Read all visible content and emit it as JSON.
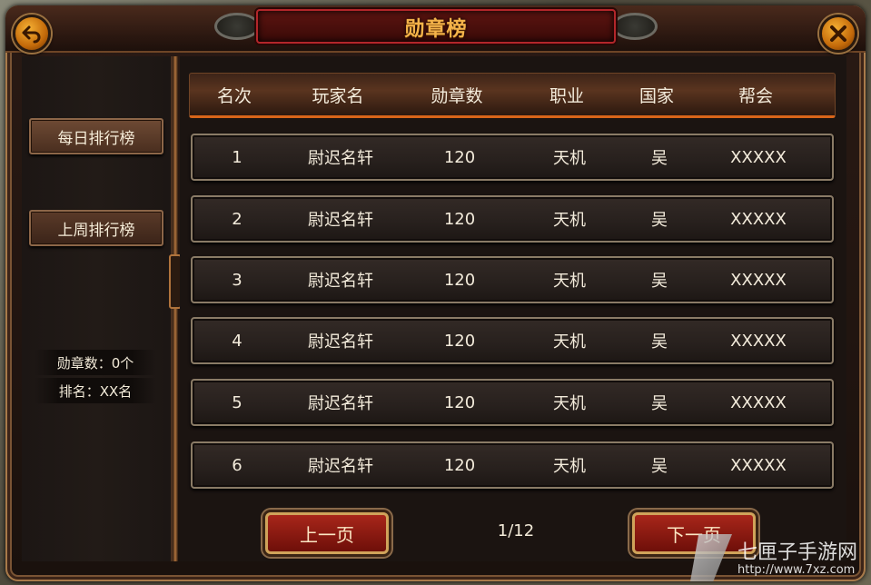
{
  "title": "勋章榜",
  "buttons": {
    "back": "back",
    "close": "close"
  },
  "sidebar": {
    "tabs": [
      "每日排行榜",
      "上周排行榜"
    ],
    "medal_count": "勋章数：0个",
    "rank": "排名：XX名"
  },
  "table": {
    "headers": [
      "名次",
      "玩家名",
      "勋章数",
      "职业",
      "国家",
      "帮会"
    ],
    "rows": [
      [
        "1",
        "尉迟名轩",
        "120",
        "天机",
        "吴",
        "XXXXX"
      ],
      [
        "2",
        "尉迟名轩",
        "120",
        "天机",
        "吴",
        "XXXXX"
      ],
      [
        "3",
        "尉迟名轩",
        "120",
        "天机",
        "吴",
        "XXXXX"
      ],
      [
        "4",
        "尉迟名轩",
        "120",
        "天机",
        "吴",
        "XXXXX"
      ],
      [
        "5",
        "尉迟名轩",
        "120",
        "天机",
        "吴",
        "XXXXX"
      ],
      [
        "6",
        "尉迟名轩",
        "120",
        "天机",
        "吴",
        "XXXXX"
      ]
    ]
  },
  "pager": {
    "prev": "上一页",
    "next": "下一页",
    "indicator": "1/12"
  },
  "watermark": {
    "name": "七匣子手游网",
    "url": "http://www.7xz.com"
  },
  "colors": {
    "accent": "#d8651a",
    "title": "#f4b34a",
    "button_red": "#a8261a"
  }
}
